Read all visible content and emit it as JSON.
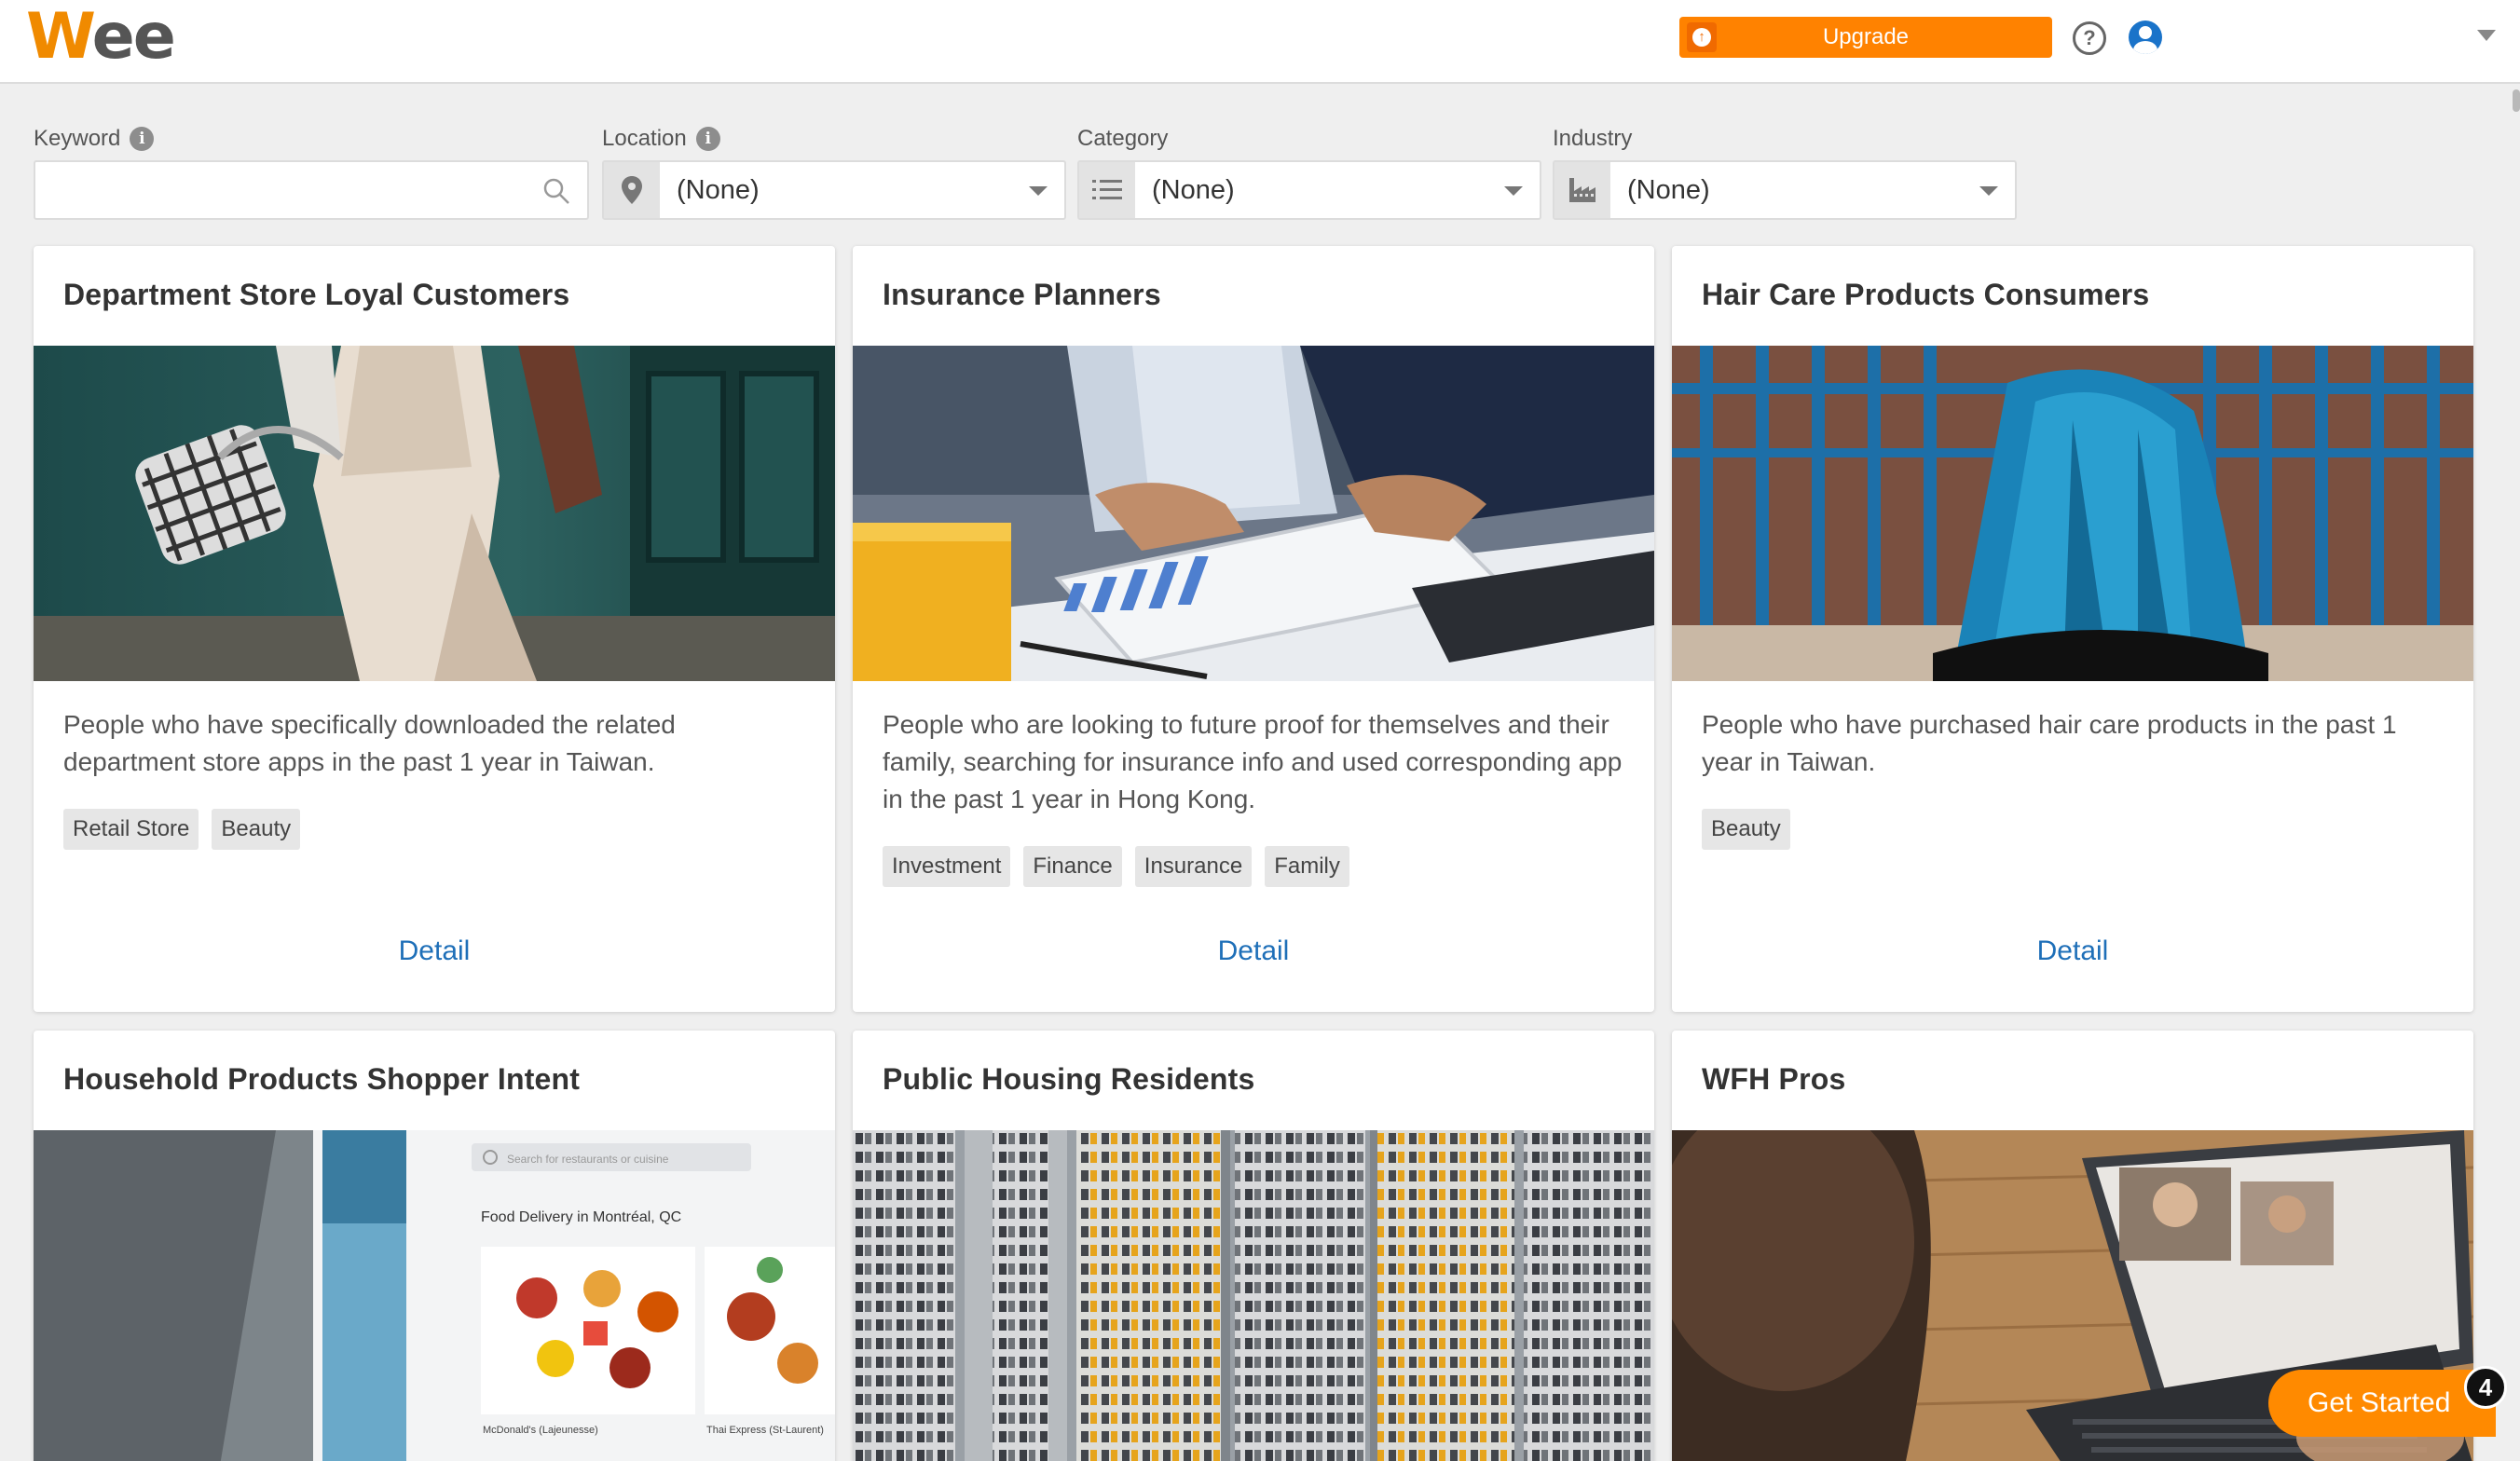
{
  "header": {
    "logo_w": "W",
    "logo_rest": "ee",
    "upgrade_label": "Upgrade",
    "icons": [
      "upgrade-icon",
      "help-icon",
      "user-icon",
      "chevron-down-icon"
    ]
  },
  "filters": {
    "keyword": {
      "label": "Keyword",
      "value": "",
      "placeholder": ""
    },
    "location": {
      "label": "Location",
      "value": "(None)"
    },
    "category": {
      "label": "Category",
      "value": "(None)"
    },
    "industry": {
      "label": "Industry",
      "value": "(None)"
    }
  },
  "cards": [
    {
      "title": "Department Store Loyal Customers",
      "description": "People who have specifically downloaded the related department store apps in the past 1 year in Taiwan.",
      "tags": [
        "Retail Store",
        "Beauty"
      ],
      "detail_label": "Detail"
    },
    {
      "title": "Insurance Planners",
      "description": "People who are looking to future proof for themselves and their family, searching for insurance info and used corresponding app in the past 1 year in Hong Kong.",
      "tags": [
        "Investment",
        "Finance",
        "Insurance",
        "Family"
      ],
      "detail_label": "Detail"
    },
    {
      "title": "Hair Care Products Consumers",
      "description": "People who have purchased hair care products in the past 1 year in Taiwan.",
      "tags": [
        "Beauty"
      ],
      "detail_label": "Detail"
    },
    {
      "title": "Household Products Shopper Intent"
    },
    {
      "title": "Public Housing Residents"
    },
    {
      "title": "WFH Pros"
    }
  ],
  "food_app": {
    "search_placeholder": "Search for restaurants or cuisine",
    "heading": "Food Delivery in Montréal, QC",
    "item1": "McDonald's (Lajeunesse)",
    "item2": "Thai Express (St-Laurent)"
  },
  "get_started": {
    "label": "Get Started",
    "badge": "4"
  }
}
